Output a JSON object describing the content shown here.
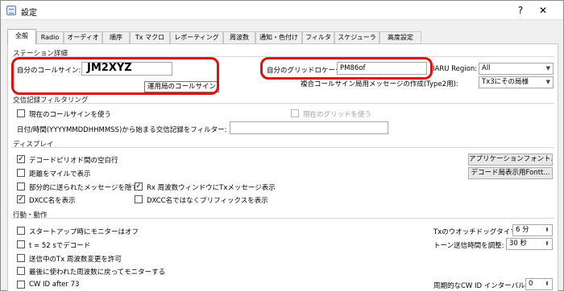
{
  "window": {
    "title": "設定",
    "help_glyph": "?",
    "close_glyph": "✕"
  },
  "tabs": [
    "全般",
    "Radio",
    "オーディオ",
    "順序",
    "Tx マクロ",
    "レポーティング",
    "周波数",
    "通知・色付け",
    "フィルタ",
    "スケジューラ",
    "高度設定"
  ],
  "station": {
    "group_title": "ステーション詳細",
    "my_call_label": "自分のコールサイン:",
    "my_call_value": "JM2XYZ",
    "tooltip": "運用局のコールサイン",
    "my_grid_label": "自分のグリッドロケータ:",
    "my_grid_value": "PM86of",
    "iaru_label": "IARU Region:",
    "iaru_value": "All",
    "type2_label": "複合コールサイン局用メッセージの作成(Type2用):",
    "type2_value": "Tx3にその局様"
  },
  "qso_filter": {
    "group_title": "交信記録フィルタリング",
    "use_current_call": "現在のコールサインを使う",
    "use_current_grid": "現在のグリッドを使う",
    "datetime_label": "日付/時間(YYYYMMDDHHMMSS)から始まる交信記録をフィルター:",
    "datetime_value": ""
  },
  "display": {
    "group_title": "ディスプレイ",
    "blank_line": "デコードピリオド間の空白行",
    "miles": "距離をマイルで表示",
    "partial": "部分的に送られたメッセージを隠す",
    "rx_window": "Rx 周波数ウィンドウにTxメッセージ表示",
    "dxcc_name": "DXCC名を表示",
    "dxcc_prefix": "DXCC名ではなくプリフィックスを表示",
    "app_font_btn": "アプリケーションフォント...",
    "decode_font_btn": "デコード局表示用Fontt..."
  },
  "behavior": {
    "group_title": "行動・動作",
    "monitor_off": "スタートアップ時にモニターはオフ",
    "decode_52": "t = 52 sでデコード",
    "allow_tx_freq": "送信中のTx 周波数変更を許可",
    "return_monitor": "最後に使われた周波数に戻ってモニターする",
    "cw_id_after": "CW ID after 73",
    "tx_watchdog_label": "Txのウオッチドッグタイマー:",
    "tx_watchdog_value": "6 分",
    "tune_timeout_label": "トーン送信時間を調整:",
    "tune_timeout_value": "30 秒",
    "cw_interval_label": "周期的なCW ID インターバル:",
    "cw_interval_value": "0"
  },
  "checks": {
    "use_current_call": false,
    "use_current_grid": false,
    "blank_line": true,
    "miles": false,
    "partial": false,
    "rx_window": true,
    "dxcc_name": true,
    "dxcc_prefix": false,
    "monitor_off": false,
    "decode_52": false,
    "allow_tx_freq": false,
    "return_monitor": false,
    "cw_id_after": false
  },
  "colors": {
    "highlight": "#e01010",
    "panel": "#ffffff",
    "chrome": "#f0f0f0"
  }
}
